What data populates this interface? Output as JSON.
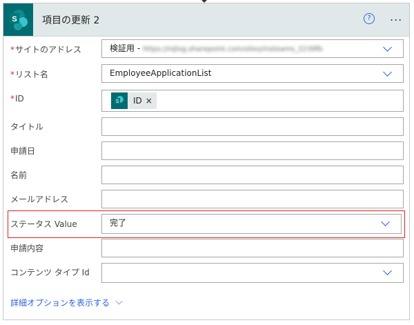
{
  "header": {
    "title": "項目の更新 2",
    "help_icon": "?",
    "more_icon": "..."
  },
  "fields": [
    {
      "label": "サイトのアドレス",
      "required": "*",
      "value": "検証用 - ",
      "blurred_url": "https://nijlog.sharepoint.com/sites/msteams_2239fb"
    },
    {
      "label": "リスト名",
      "required": "*",
      "value": "EmployeeApplicationList"
    },
    {
      "label": "ID",
      "required": "*",
      "token": "ID",
      "token_remove": "×"
    },
    {
      "label": "タイトル",
      "value": ""
    },
    {
      "label": "申請日",
      "value": ""
    },
    {
      "label": "名前",
      "value": ""
    },
    {
      "label": "メールアドレス",
      "value": ""
    },
    {
      "label": "ステータス Value",
      "value": "完了"
    },
    {
      "label": "申請内容",
      "value": ""
    },
    {
      "label": "コンテンツ タイプ Id",
      "value": ""
    }
  ],
  "advanced_link": "詳細オプションを表示する",
  "colors": {
    "accent": "#2f62e0",
    "highlight": "#e0201b",
    "brand": "#036c70"
  }
}
